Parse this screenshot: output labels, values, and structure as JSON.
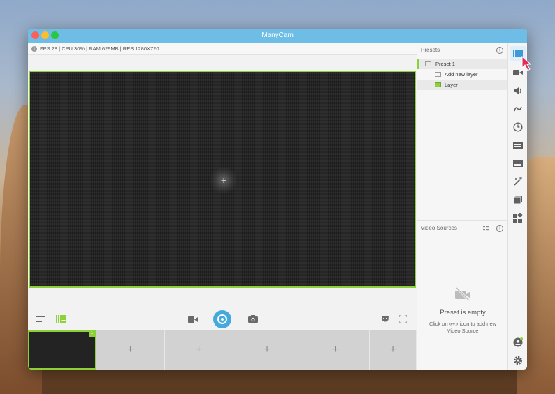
{
  "window": {
    "title": "ManyCam"
  },
  "statusbar": {
    "text": "FPS 28 | CPU 30% | RAM 629MB | RES 1280X720",
    "info_glyph": "i"
  },
  "preview": {
    "add_glyph": "+"
  },
  "scenes": {
    "active_badge": "1",
    "items": [
      {
        "label": "",
        "active": true
      },
      {
        "label": "+",
        "active": false
      },
      {
        "label": "+",
        "active": false
      },
      {
        "label": "+",
        "active": false
      },
      {
        "label": "+",
        "active": false
      },
      {
        "label": "+",
        "active": false
      }
    ]
  },
  "presets_panel": {
    "title": "Presets",
    "add_glyph": "+",
    "preset_name": "Preset 1",
    "add_layer_label": "Add new layer",
    "layer_label": "Layer"
  },
  "video_sources": {
    "title": "Video Sources",
    "add_glyph": "+",
    "empty_title": "Preset is empty",
    "empty_desc": "Click on «+» icon to add new Video Source"
  },
  "colors": {
    "accent_green": "#8dd13a",
    "titlebar_blue": "#6ebde6",
    "broadcast_blue": "#44a9dd"
  },
  "icons": {
    "rail": [
      "presets-icon",
      "video-icon",
      "volume-icon",
      "drawing-icon",
      "clock-icon",
      "lower-thirds-icon",
      "title-icon",
      "effects-wand-icon",
      "images-icon",
      "widgets-icon",
      "account-icon",
      "settings-icon"
    ]
  }
}
